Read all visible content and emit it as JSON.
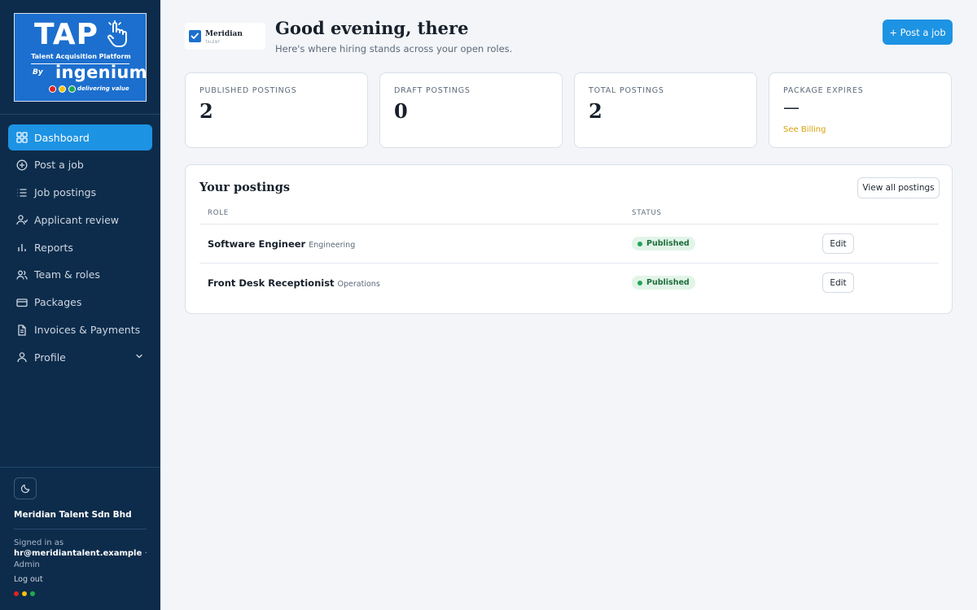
{
  "brand": {
    "logo_word": "TAP",
    "logo_subtitle": "Talent Acquisition Platform",
    "logo_by": "By",
    "logo_company": "ingenium",
    "logo_tagline": "delivering value",
    "colors": {
      "primary": "#1d93e3",
      "sidebar": "#0d2c4b",
      "dot_red": "#e0241b",
      "dot_yellow": "#f4c20d",
      "dot_green": "#1faa4b"
    }
  },
  "sidebar": {
    "items": [
      {
        "label": "Dashboard",
        "icon": "dashboard-grid-icon",
        "active": true
      },
      {
        "label": "Post a job",
        "icon": "plus-circle-icon"
      },
      {
        "label": "Job postings",
        "icon": "list-icon"
      },
      {
        "label": "Applicant review",
        "icon": "users-icon"
      },
      {
        "label": "Reports",
        "icon": "bar-chart-icon"
      },
      {
        "label": "Team & roles",
        "icon": "team-icon"
      },
      {
        "label": "Packages",
        "icon": "credit-card-icon"
      },
      {
        "label": "Invoices & Payments",
        "icon": "document-icon"
      },
      {
        "label": "Profile",
        "icon": "user-icon",
        "has_submenu": true
      }
    ],
    "theme_toggle_icon": "moon-icon",
    "company_name": "Meridian Talent Sdn Bhd",
    "signed_in_label": "Signed in as",
    "user_email": "hr@meridiantalent.example",
    "separator": "·",
    "user_role": "Admin",
    "logout_label": "Log out"
  },
  "header": {
    "client_logo_name": "Meridian",
    "client_logo_sub": "TALENT",
    "greeting": "Good evening, there",
    "subtitle": "Here's where hiring stands across your open roles.",
    "post_job_label": "+ Post a job"
  },
  "stats": [
    {
      "label": "PUBLISHED POSTINGS",
      "value": "2"
    },
    {
      "label": "DRAFT POSTINGS",
      "value": "0"
    },
    {
      "label": "TOTAL POSTINGS",
      "value": "2"
    },
    {
      "label": "PACKAGE EXPIRES",
      "value": "—",
      "link": "See Billing"
    }
  ],
  "postings": {
    "title": "Your postings",
    "view_all_label": "View all postings",
    "columns": [
      "ROLE",
      "STATUS"
    ],
    "rows": [
      {
        "role": "Software Engineer",
        "department": "Engineering",
        "status": "Published",
        "action": "Edit"
      },
      {
        "role": "Front Desk Receptionist",
        "department": "Operations",
        "status": "Published",
        "action": "Edit"
      }
    ]
  }
}
